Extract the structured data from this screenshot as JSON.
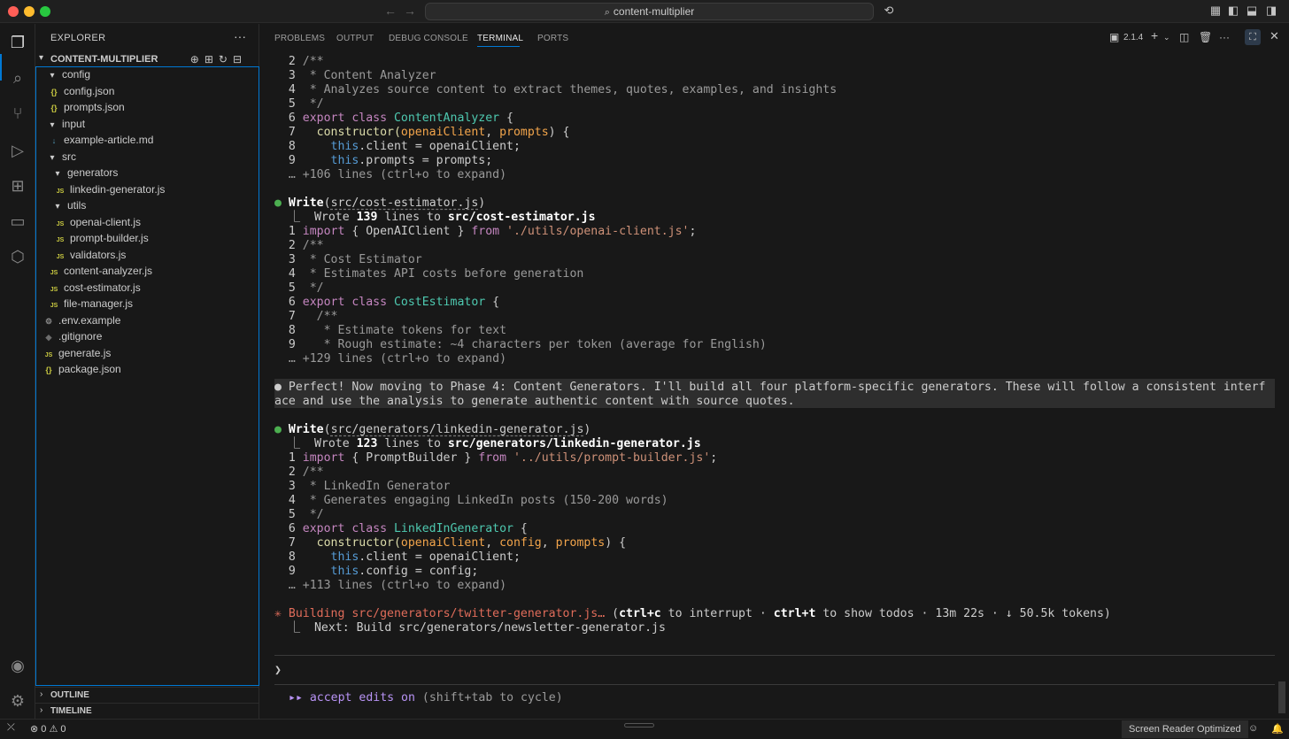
{
  "window": {
    "search_text": "content-multiplier"
  },
  "sidebar": {
    "title": "EXPLORER",
    "more": "···",
    "root_label": "CONTENT-MULTIPLIER",
    "items": [
      {
        "label": "config",
        "icon": "▾"
      },
      {
        "label": "config.json",
        "icon": "{}"
      },
      {
        "label": "prompts.json",
        "icon": "{}"
      },
      {
        "label": "input",
        "icon": "▾"
      },
      {
        "label": "example-article.md",
        "icon": "↓"
      },
      {
        "label": "src",
        "icon": "▾"
      },
      {
        "label": "generators",
        "icon": "▾"
      },
      {
        "label": "linkedin-generator.js",
        "icon": "JS"
      },
      {
        "label": "utils",
        "icon": "▾"
      },
      {
        "label": "openai-client.js",
        "icon": "JS"
      },
      {
        "label": "prompt-builder.js",
        "icon": "JS"
      },
      {
        "label": "validators.js",
        "icon": "JS"
      },
      {
        "label": "content-analyzer.js",
        "icon": "JS"
      },
      {
        "label": "cost-estimator.js",
        "icon": "JS"
      },
      {
        "label": "file-manager.js",
        "icon": "JS"
      },
      {
        "label": ".env.example",
        "icon": "⚙"
      },
      {
        "label": ".gitignore",
        "icon": "◆"
      },
      {
        "label": "generate.js",
        "icon": "JS"
      },
      {
        "label": "package.json",
        "icon": "{}"
      }
    ],
    "outline": "OUTLINE",
    "timeline": "TIMELINE"
  },
  "panel": {
    "tabs": [
      "PROBLEMS",
      "OUTPUT",
      "DEBUG CONSOLE",
      "TERMINAL",
      "PORTS"
    ],
    "active_tab": "TERMINAL",
    "terminal_version": "2.1.4"
  },
  "terminal": {
    "block1": {
      "l2": "  2 ",
      "l2c": "/**",
      "l3": "  3 ",
      "l3c": " * Content Analyzer",
      "l4": "  4 ",
      "l4c": " * Analyzes source content to extract themes, quotes, examples, and insights",
      "l5": "  5 ",
      "l5c": " */",
      "l6": "  6 ",
      "l6_kw": "export class ",
      "l6_cls": "ContentAnalyzer",
      "l6_rest": " {",
      "l7": "  7 ",
      "l7_fn": "  constructor(",
      "l7_p1": "openaiClient",
      "l7_sep": ", ",
      "l7_p2": "prompts",
      "l7_end": ") {",
      "l8": "  8 ",
      "l8_this": "    this",
      "l8_rest": ".client = openaiClient;",
      "l9": "  9 ",
      "l9_this": "    this",
      "l9_rest": ".prompts = prompts;",
      "more": "  … +106 lines (ctrl+o to expand)"
    },
    "write1": {
      "bullet": "●",
      "verb": "Write",
      "path": "src/cost-estimator.js",
      "wrote_prefix": "  ⎿  Wrote ",
      "wrote_count": "139",
      "wrote_mid": " lines to ",
      "wrote_path": "src/cost-estimator.js",
      "l1": "  1 ",
      "l1_kw": "import",
      "l1_mid": " { OpenAIClient } ",
      "l1_from": "from",
      "l1_str": " './utils/openai-client.js'",
      "l1_end": ";",
      "l2": "  2 ",
      "l2c": "/**",
      "l3": "  3 ",
      "l3c": " * Cost Estimator",
      "l4": "  4 ",
      "l4c": " * Estimates API costs before generation",
      "l5": "  5 ",
      "l5c": " */",
      "l6": "  6 ",
      "l6_kw": "export class ",
      "l6_cls": "CostEstimator",
      "l6_rest": " {",
      "l7": "  7 ",
      "l7c": "  /**",
      "l8": "  8 ",
      "l8c": "   * Estimate tokens for text",
      "l9": "  9 ",
      "l9c": "   * Rough estimate: ~4 characters per token (average for English)",
      "more": "  … +129 lines (ctrl+o to expand)"
    },
    "message": {
      "line1": "● Perfect! Now moving to Phase 4: Content Generators. I'll build all four platform-specific generators. These will follow a consistent interf",
      "line2": "ace and use the analysis to generate authentic content with source quotes."
    },
    "write2": {
      "bullet": "●",
      "verb": "Write",
      "path": "src/generators/linkedin-generator.js",
      "wrote_prefix": "  ⎿  Wrote ",
      "wrote_count": "123",
      "wrote_mid": " lines to ",
      "wrote_path": "src/generators/linkedin-generator.js",
      "l1": "  1 ",
      "l1_kw": "import",
      "l1_mid": " { PromptBuilder } ",
      "l1_from": "from",
      "l1_str": " '../utils/prompt-builder.js'",
      "l1_end": ";",
      "l2": "  2 ",
      "l2c": "/**",
      "l3": "  3 ",
      "l3c": " * LinkedIn Generator",
      "l4": "  4 ",
      "l4c": " * Generates engaging LinkedIn posts (150-200 words)",
      "l5": "  5 ",
      "l5c": " */",
      "l6": "  6 ",
      "l6_kw": "export class ",
      "l6_cls": "LinkedInGenerator",
      "l6_rest": " {",
      "l7": "  7 ",
      "l7_fn": "  constructor(",
      "l7_p1": "openaiClient",
      "l7_sep1": ", ",
      "l7_p2": "config",
      "l7_sep2": ", ",
      "l7_p3": "prompts",
      "l7_end": ") {",
      "l8": "  8 ",
      "l8_this": "    this",
      "l8_rest": ".client = openaiClient;",
      "l9": "  9 ",
      "l9_this": "    this",
      "l9_rest": ".config = config;",
      "more": "  … +113 lines (ctrl+o to expand)"
    },
    "status": {
      "spinner": "✳",
      "building": " Building src/generators/twitter-generator.js… ",
      "paren_open": "(",
      "k1": "ctrl+c",
      "t1": " to interrupt · ",
      "k2": "ctrl+t",
      "t2": " to show todos · 13m 22s · ↓ 50.5k tokens)",
      "next": "  ⎿  Next: Build src/generators/newsletter-generator.js"
    },
    "prompt": "❯",
    "mode_arrows": "▸▸",
    "mode_text": " accept edits on",
    "mode_hint": " (shift+tab to cycle)"
  },
  "statusbar": {
    "errors": "0",
    "warnings": "0",
    "screen_reader": "Screen Reader Optimized"
  }
}
